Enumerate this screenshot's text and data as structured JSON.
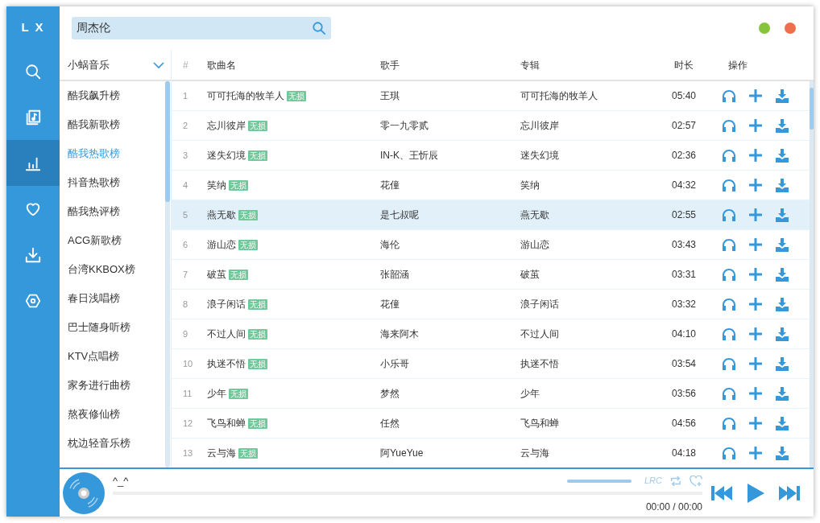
{
  "logo": "L X",
  "nav": [
    {
      "kind": "search",
      "selected": false
    },
    {
      "kind": "music",
      "selected": false
    },
    {
      "kind": "chart",
      "selected": true
    },
    {
      "kind": "heart",
      "selected": false
    },
    {
      "kind": "download",
      "selected": false
    },
    {
      "kind": "settings",
      "selected": false
    }
  ],
  "search": {
    "value": "周杰伦"
  },
  "window_buttons": [
    {
      "color": "#85c43b"
    },
    {
      "color": "#ef6e4d"
    }
  ],
  "source": {
    "label": "小蜗音乐"
  },
  "boards": [
    {
      "label": "酷我飙升榜",
      "selected": false
    },
    {
      "label": "酷我新歌榜",
      "selected": false
    },
    {
      "label": "酷我热歌榜",
      "selected": true
    },
    {
      "label": "抖音热歌榜",
      "selected": false
    },
    {
      "label": "酷我热评榜",
      "selected": false
    },
    {
      "label": "ACG新歌榜",
      "selected": false
    },
    {
      "label": "台湾KKBOX榜",
      "selected": false
    },
    {
      "label": "春日浅唱榜",
      "selected": false
    },
    {
      "label": "巴士随身听榜",
      "selected": false
    },
    {
      "label": "KTV点唱榜",
      "selected": false
    },
    {
      "label": "家务进行曲榜",
      "selected": false
    },
    {
      "label": "熬夜修仙榜",
      "selected": false
    },
    {
      "label": "枕边轻音乐榜",
      "selected": false
    }
  ],
  "table": {
    "columns": [
      "#",
      "歌曲名",
      "歌手",
      "专辑",
      "时长",
      "操作"
    ],
    "rows": [
      {
        "index": "1",
        "title": "可可托海的牧羊人",
        "tag": "无损",
        "artist": "王琪",
        "album": "可可托海的牧羊人",
        "duration": "05:40",
        "selected": false
      },
      {
        "index": "2",
        "title": "忘川彼岸",
        "tag": "无损",
        "artist": "零一九零贰",
        "album": "忘川彼岸",
        "duration": "02:57",
        "selected": false
      },
      {
        "index": "3",
        "title": "迷失幻境",
        "tag": "无损",
        "artist": "IN-K、王忻辰",
        "album": "迷失幻境",
        "duration": "02:36",
        "selected": false
      },
      {
        "index": "4",
        "title": "笑纳",
        "tag": "无损",
        "artist": "花僮",
        "album": "笑纳",
        "duration": "04:32",
        "selected": false
      },
      {
        "index": "5",
        "title": "燕无歇",
        "tag": "无损",
        "artist": "是七叔呢",
        "album": "燕无歇",
        "duration": "02:55",
        "selected": true
      },
      {
        "index": "6",
        "title": "游山恋",
        "tag": "无损",
        "artist": "海伦",
        "album": "游山恋",
        "duration": "03:43",
        "selected": false
      },
      {
        "index": "7",
        "title": "破茧",
        "tag": "无损",
        "artist": "张韶涵",
        "album": "破茧",
        "duration": "03:31",
        "selected": false
      },
      {
        "index": "8",
        "title": "浪子闲话",
        "tag": "无损",
        "artist": "花僮",
        "album": "浪子闲话",
        "duration": "03:32",
        "selected": false
      },
      {
        "index": "9",
        "title": "不过人间",
        "tag": "无损",
        "artist": "海来阿木",
        "album": "不过人间",
        "duration": "04:10",
        "selected": false
      },
      {
        "index": "10",
        "title": "执迷不悟",
        "tag": "无损",
        "artist": "小乐哥",
        "album": "执迷不悟",
        "duration": "03:54",
        "selected": false
      },
      {
        "index": "11",
        "title": "少年",
        "tag": "无损",
        "artist": "梦然",
        "album": "少年",
        "duration": "03:56",
        "selected": false
      },
      {
        "index": "12",
        "title": "飞鸟和蝉",
        "tag": "无损",
        "artist": "任然",
        "album": "飞鸟和蝉",
        "duration": "04:56",
        "selected": false
      },
      {
        "index": "13",
        "title": "云与海",
        "tag": "无损",
        "artist": "阿YueYue",
        "album": "云与海",
        "duration": "04:18",
        "selected": false
      }
    ]
  },
  "player": {
    "title": "^_^",
    "volume": {
      "level": 1
    },
    "lyrics_button": "LRC",
    "progress": {
      "level": 0
    },
    "time": "00:00 / 00:00"
  }
}
